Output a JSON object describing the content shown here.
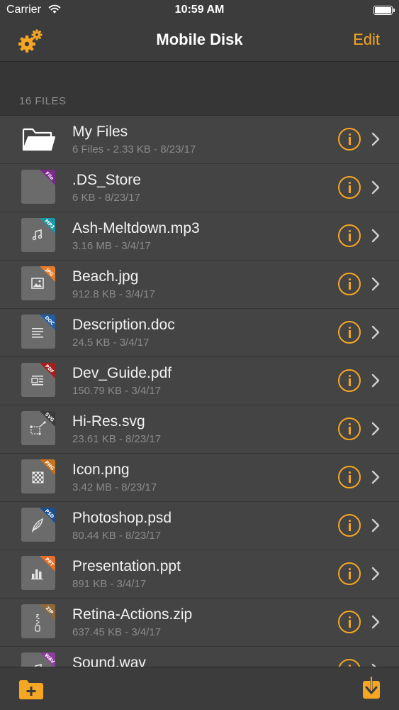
{
  "status_bar": {
    "carrier": "Carrier",
    "time": "10:59 AM"
  },
  "nav": {
    "title": "Mobile Disk",
    "edit_label": "Edit"
  },
  "section": {
    "label": "16 FILES"
  },
  "colors": {
    "accent": "#f5a623",
    "background": "#363636",
    "row": "#444444"
  },
  "files": [
    {
      "name": "My Files",
      "meta": "6 Files - 2.33 KB - 8/23/17",
      "type": "folder",
      "badge": "",
      "badge_color": "",
      "glyph": "folder-icon"
    },
    {
      "name": ".DS_Store",
      "meta": "6 KB - 8/23/17",
      "type": "file",
      "badge": "File",
      "badge_color": "#7b2a8c",
      "glyph": "blank"
    },
    {
      "name": "Ash-Meltdown.mp3",
      "meta": "3.16 MB - 3/4/17",
      "type": "file",
      "badge": "MP3",
      "badge_color": "#1a9aa8",
      "glyph": "music-note"
    },
    {
      "name": "Beach.jpg",
      "meta": "912.8 KB - 3/4/17",
      "type": "file",
      "badge": "JPG",
      "badge_color": "#e77d2a",
      "glyph": "image"
    },
    {
      "name": "Description.doc",
      "meta": "24.5 KB - 3/4/17",
      "type": "file",
      "badge": "DOC",
      "badge_color": "#1f5fa8",
      "glyph": "text-lines"
    },
    {
      "name": "Dev_Guide.pdf",
      "meta": "150.79 KB - 3/4/17",
      "type": "file",
      "badge": "PDF",
      "badge_color": "#a51d1d",
      "glyph": "document"
    },
    {
      "name": "Hi-Res.svg",
      "meta": "23.61 KB - 8/23/17",
      "type": "file",
      "badge": "SVG",
      "badge_color": "#3b3b3b",
      "glyph": "vector"
    },
    {
      "name": "Icon.png",
      "meta": "3.42 MB - 8/23/17",
      "type": "file",
      "badge": "PNG",
      "badge_color": "#c8731d",
      "glyph": "checker"
    },
    {
      "name": "Photoshop.psd",
      "meta": "80.44 KB - 8/23/17",
      "type": "file",
      "badge": "PSD",
      "badge_color": "#1a4f8f",
      "glyph": "feather"
    },
    {
      "name": "Presentation.ppt",
      "meta": "891 KB - 3/4/17",
      "type": "file",
      "badge": "PPT",
      "badge_color": "#e7702a",
      "glyph": "bar-chart"
    },
    {
      "name": "Retina-Actions.zip",
      "meta": "637.45 KB - 3/4/17",
      "type": "file",
      "badge": "ZIP",
      "badge_color": "#8d6a3a",
      "glyph": "zipper"
    },
    {
      "name": "Sound.wav",
      "meta": "",
      "type": "file",
      "badge": "WAV",
      "badge_color": "#8f3ea0",
      "glyph": "music-note"
    }
  ],
  "toolbar": {
    "new_folder_icon": "new-folder-icon",
    "download_icon": "download-icon"
  }
}
